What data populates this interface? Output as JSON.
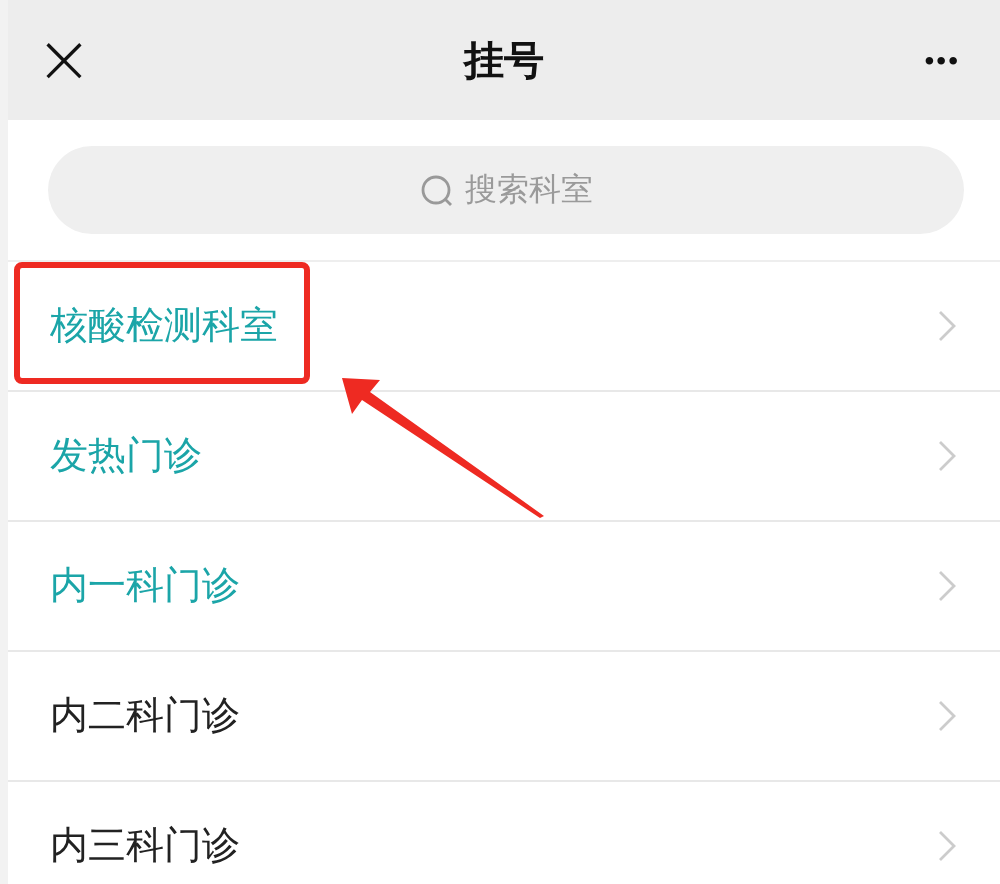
{
  "header": {
    "close": "×",
    "title": "挂号",
    "more": "•••"
  },
  "search": {
    "placeholder": "搜索科室"
  },
  "departments": [
    {
      "name": "核酸检测科室",
      "color": "#1ba5a8",
      "marked": true
    },
    {
      "name": "发热门诊",
      "color": "#1ba5a8",
      "marked": false
    },
    {
      "name": "内一科门诊",
      "color": "#1ba5a8",
      "marked": false
    },
    {
      "name": "内二科门诊",
      "color": "#222222",
      "marked": false
    },
    {
      "name": "内三科门诊",
      "color": "#222222",
      "marked": false
    }
  ]
}
